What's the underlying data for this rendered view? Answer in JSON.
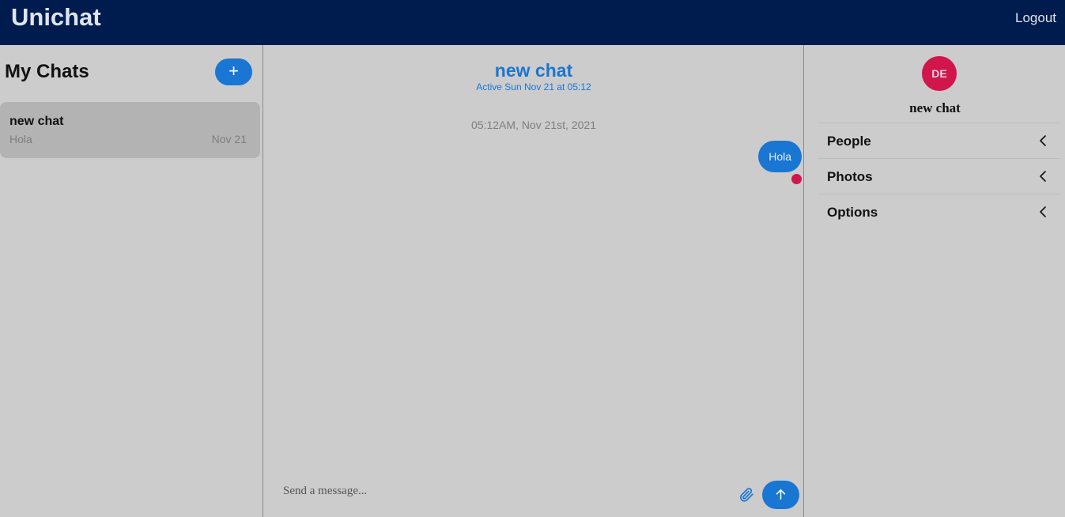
{
  "app": {
    "title": "Unichat",
    "logout_label": "Logout"
  },
  "chat_list": {
    "title": "My Chats",
    "new_chat_symbol": "+",
    "chats": [
      {
        "title": "new chat",
        "preview": "Hola",
        "date": "Nov 21"
      }
    ]
  },
  "chat_feed": {
    "title": "new chat",
    "subtitle": "Active Sun Nov 21 at 05:12",
    "timestamp": "05:12AM, Nov 21st, 2021",
    "messages": [
      {
        "text": "Hola"
      }
    ],
    "input_placeholder": "Send a message...",
    "icons": {
      "attach": "paperclip-icon",
      "send": "arrow-up-icon",
      "read_receipt": "read-receipt-dot"
    }
  },
  "chat_settings": {
    "avatar_initials": "DE",
    "title": "new chat",
    "sections": [
      {
        "label": "People"
      },
      {
        "label": "Photos"
      },
      {
        "label": "Options"
      }
    ]
  },
  "colors": {
    "navbar": "#001c4f",
    "background": "#cccccc",
    "accent": "#1976d2",
    "avatar": "#d1164c",
    "selected_card": "#b3b3b3"
  }
}
